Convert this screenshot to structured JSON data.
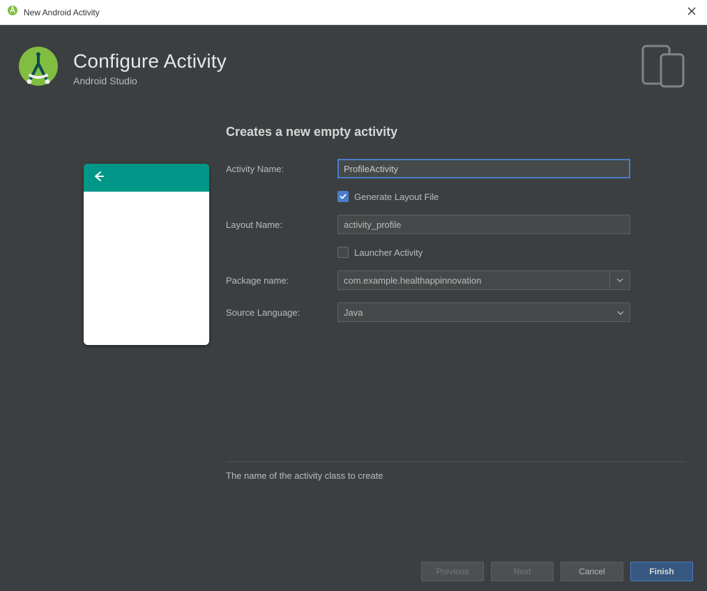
{
  "window": {
    "title": "New Android Activity"
  },
  "header": {
    "title": "Configure Activity",
    "subtitle": "Android Studio"
  },
  "form": {
    "heading": "Creates a new empty activity",
    "activity_name_label": "Activity Name:",
    "activity_name_value": "ProfileActivity",
    "generate_layout_label": "Generate Layout File",
    "generate_layout_checked": true,
    "layout_name_label": "Layout Name:",
    "layout_name_value": "activity_profile",
    "launcher_activity_label": "Launcher Activity",
    "launcher_activity_checked": false,
    "package_name_label": "Package name:",
    "package_name_value": "com.example.healthappinnovation",
    "source_language_label": "Source Language:",
    "source_language_value": "Java",
    "hint": "The name of the activity class to create"
  },
  "buttons": {
    "previous": "Previous",
    "next": "Next",
    "cancel": "Cancel",
    "finish": "Finish"
  }
}
